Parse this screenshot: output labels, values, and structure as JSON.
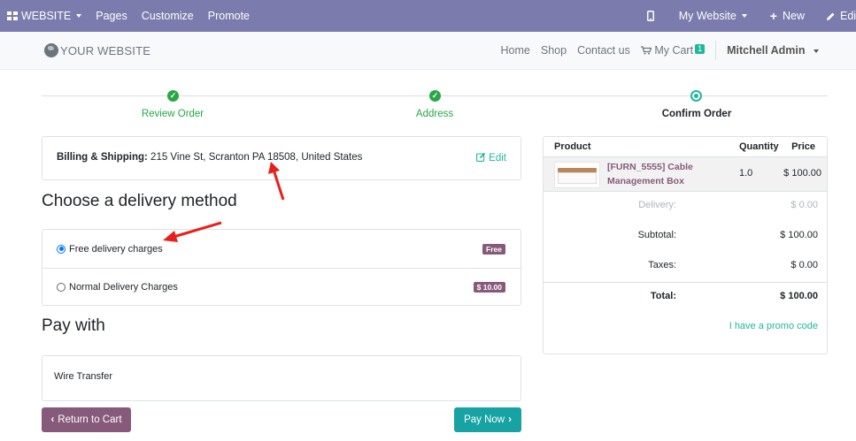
{
  "admin_bar": {
    "website_menu": "WEBSITE",
    "pages": "Pages",
    "customize": "Customize",
    "promote": "Promote",
    "my_website": "My Website",
    "new": "New",
    "edit": "Edit"
  },
  "header": {
    "logo": "YOUR WEBSITE",
    "nav": [
      "Home",
      "Shop",
      "Contact us"
    ],
    "cart_label": "My Cart",
    "cart_count": "1",
    "user": "Mitchell Admin"
  },
  "wizard": {
    "steps": [
      {
        "label": "Review Order",
        "state": "done"
      },
      {
        "label": "Address",
        "state": "done"
      },
      {
        "label": "Confirm Order",
        "state": "current"
      }
    ]
  },
  "address": {
    "label": "Billing & Shipping:",
    "value": "215 Vine St, Scranton PA 18508, United States",
    "edit": "Edit"
  },
  "delivery": {
    "title": "Choose a delivery method",
    "options": [
      {
        "label": "Free delivery charges",
        "price": "Free",
        "selected": true
      },
      {
        "label": "Normal Delivery Charges",
        "price": "$ 10.00",
        "selected": false
      }
    ]
  },
  "payment": {
    "title": "Pay with",
    "method": "Wire Transfer",
    "return_button": "Return to Cart",
    "pay_button": "Pay Now"
  },
  "summary": {
    "columns": [
      "Product",
      "Quantity",
      "Price"
    ],
    "item": {
      "name": "[FURN_5555] Cable Management Box",
      "quantity": "1.0",
      "price": "$ 100.00"
    },
    "delivery_label": "Delivery:",
    "delivery_value": "$ 0.00",
    "subtotal_label": "Subtotal:",
    "subtotal_value": "$ 100.00",
    "taxes_label": "Taxes:",
    "taxes_value": "$ 0.00",
    "total_label": "Total:",
    "total_value": "$ 100.00",
    "promo": "I have a promo code"
  },
  "colors": {
    "admin_bar": "#7c7bad",
    "primary": "#875a7b",
    "accent": "#21b799",
    "success": "#28a745",
    "annotation": "#e8201c"
  }
}
